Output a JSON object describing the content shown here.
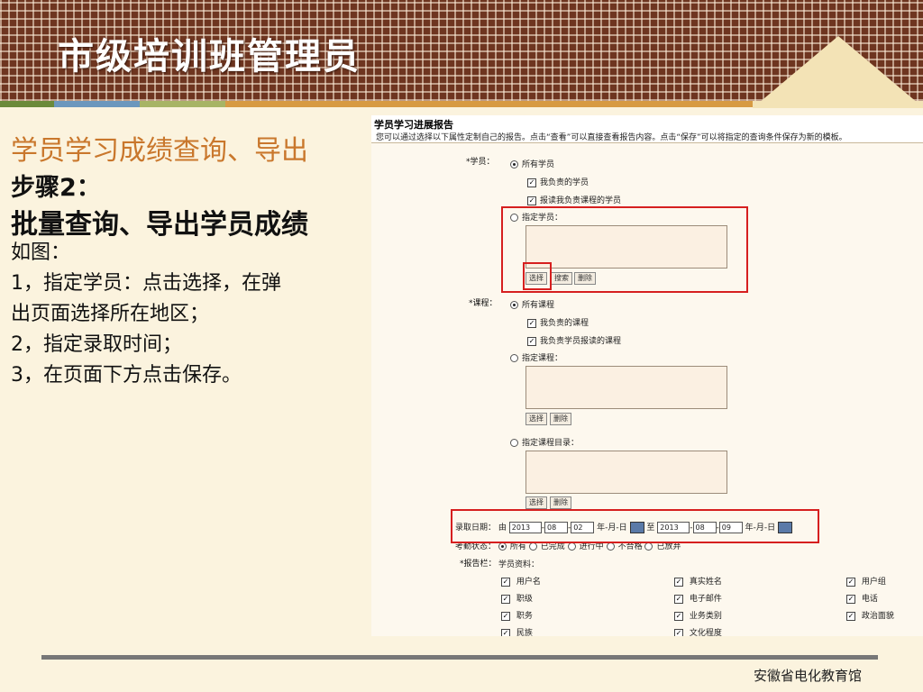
{
  "slide_title": "市级培训班管理员",
  "left": {
    "heading": "学员学习成绩查询、导出",
    "step": "步骤2：",
    "subheading": "批量查询、导出学员成绩",
    "lines": [
      "如图：",
      "1，指定学员：点击选择，在弹",
      "出页面选择所在地区；",
      "2，指定录取时间；",
      "3，在页面下方点击保存。"
    ]
  },
  "report": {
    "title": "学员学习进展报告",
    "desc": "您可以通过选择以下属性定制自己的报告。点击“查看”可以直接查看报告内容。点击“保存”可以将指定的查询条件保存为新的模板。",
    "student_label": "*学员：",
    "all_students": "所有学员",
    "my_students": "我负责的学员",
    "enrolled_students": "报读我负责课程的学员",
    "specify_student": "指定学员：",
    "btn_select": "选择",
    "btn_search": "搜索",
    "btn_delete": "删除",
    "course_label": "*课程：",
    "all_courses": "所有课程",
    "my_courses": "我负责的课程",
    "student_courses": "我负责学员报读的课程",
    "specify_course": "指定课程：",
    "specify_catalog": "指定课程目录：",
    "date_label": "录取日期：",
    "from": "由",
    "to": "至",
    "from_y": "2013",
    "from_m": "08",
    "from_d": "02",
    "to_y": "2013",
    "to_m": "08",
    "to_d": "09",
    "date_fmt": "年-月-日",
    "status_label": "考勤状态：",
    "status_options": [
      "所有",
      "已完成",
      "进行中",
      "不合格",
      "已放弃"
    ],
    "report_label": "*报告栏：",
    "profile_label": "学员资料：",
    "fields": [
      "用户名",
      "真实姓名",
      "用户组",
      "职级",
      "电子邮件",
      "电话",
      "职务",
      "业务类别",
      "政治面貌",
      "民族",
      "文化程度"
    ]
  },
  "footer": "安徽省电化教育馆",
  "colors": {
    "header_brown": "#6e3520",
    "accent_orange": "#c9772c",
    "highlight_red": "#d61f1f"
  }
}
